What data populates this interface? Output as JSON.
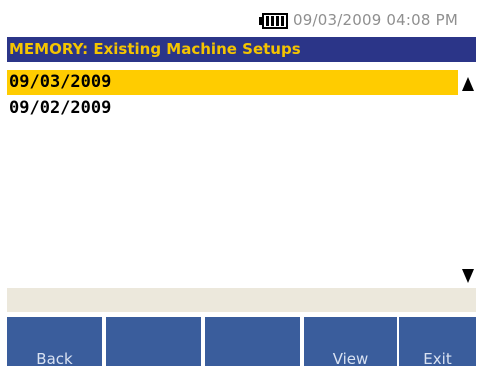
{
  "status_bar": {
    "battery_icon": "battery-full-icon",
    "datetime": "09/03/2009 04:08 PM"
  },
  "title_bar": {
    "title": "MEMORY: Existing Machine Setups"
  },
  "setups_list": {
    "items": [
      {
        "label": "09/03/2009",
        "selected": true
      },
      {
        "label": "09/02/2009",
        "selected": false
      }
    ],
    "scroll_up_icon": "triangle-up-icon",
    "scroll_down_icon": "triangle-down-icon"
  },
  "softkeys": [
    {
      "label": "Back"
    },
    {
      "label": ""
    },
    {
      "label": ""
    },
    {
      "label": "View"
    },
    {
      "label": "Exit"
    }
  ],
  "colors": {
    "title_bar_bg": "#2b3588",
    "title_text": "#f4c400",
    "selection": "#ffcc00",
    "softkey_bg": "#3a5d9c",
    "message_strip": "#ece8dc"
  }
}
